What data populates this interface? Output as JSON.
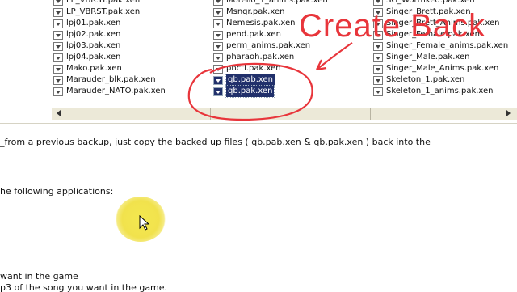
{
  "columns": [
    {
      "name": "col1",
      "items": [
        "LP_VBRST.pak.xen",
        "lpj01.pak.xen",
        "lpj02.pak.xen",
        "lpj03.pak.xen",
        "lpj04.pak.xen",
        "Mako.pak.xen",
        "Marauder_blk.pak.xen",
        "Marauder_NATO.pak.xen"
      ],
      "partial_top": "LP_VBRST.pak.xen"
    },
    {
      "name": "col2",
      "items": [
        "Msngr.pak.xen",
        "Nemesis.pak.xen",
        "pend.pak.xen",
        "perm_anims.pak.xen",
        "pharaoh.pak.xen",
        "pnctl.pak.xen",
        "qb.pab.xen",
        "qb.pak.xen"
      ],
      "partial_top": "Morello_1_anims.pak.xen"
    },
    {
      "name": "col3",
      "items": [
        "Singer_Brett.pak.xen",
        "Singer_Brett_Anims.pak.xen",
        "Singer_Female.pak.xen",
        "Singer_Female_anims.pak.xen",
        "Singer_Male.pak.xen",
        "Singer_Male_Anims.pak.xen",
        "Skeleton_1.pak.xen",
        "Skeleton_1_anims.pak.xen"
      ],
      "partial_top": "SG_Worthked.pak.xen"
    }
  ],
  "selected_items": [
    "qb.pab.xen",
    "qb.pak.xen"
  ],
  "annotation": {
    "text": "Create Back",
    "color": "#e8353b"
  },
  "instructions": {
    "line1": "_from a previous backup, just copy the backed up files ( qb.pab.xen & qb.pak.xen ) back into the",
    "line2": "he following applications:",
    "line3": " want in the game",
    "line4": "p3 of the song you want in the game."
  },
  "icons": {
    "file": "file-icon",
    "cursor": "mouse-cursor-icon"
  }
}
